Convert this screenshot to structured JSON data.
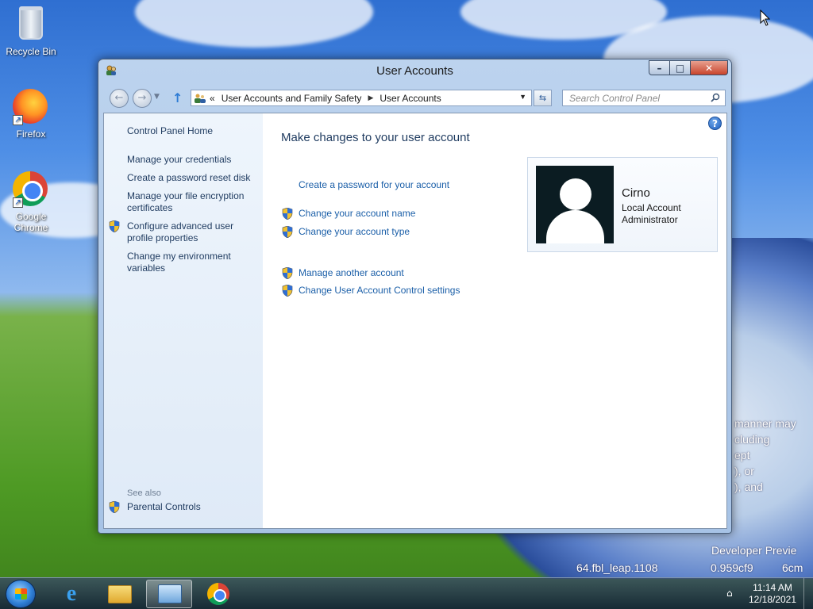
{
  "desktop": {
    "icons": [
      {
        "label": "Recycle Bin",
        "icon": "recycle-bin-icon"
      },
      {
        "label": "Firefox",
        "icon": "firefox-icon"
      },
      {
        "label": "Google Chrome",
        "icon": "chrome-icon"
      }
    ],
    "wallpaper_text": {
      "line1": "manner may",
      "line2": "cluding",
      "line3": "ept",
      "line4": "), or",
      "line5": "), and",
      "line6": "Developer Previe",
      "line7": "64.fbl_leap.1108",
      "line8": "0.959cf9",
      "line9": "6cm"
    }
  },
  "window": {
    "title": "User Accounts",
    "controls": {
      "minimize": "–",
      "maximize": "□",
      "close": "✕"
    },
    "breadcrumb": {
      "prefix": "«",
      "items": [
        "User Accounts and Family Safety",
        "User Accounts"
      ]
    },
    "search_placeholder": "Search Control Panel",
    "help": "?"
  },
  "left_pane": {
    "home": "Control Panel Home",
    "links": [
      "Manage your credentials",
      "Create a password reset disk",
      "Manage your file encryption certificates",
      "Configure advanced user profile properties",
      "Change my environment variables"
    ],
    "see_also_label": "See also",
    "see_also_links": [
      "Parental Controls"
    ]
  },
  "main": {
    "heading": "Make changes to your user account",
    "tasks_group1": [
      {
        "label": "Create a password for your account",
        "shield": false
      },
      {
        "label": "Change your account name",
        "shield": true
      },
      {
        "label": "Change your account type",
        "shield": true
      }
    ],
    "tasks_group2": [
      {
        "label": "Manage another account",
        "shield": true
      },
      {
        "label": "Change User Account Control settings",
        "shield": true
      }
    ]
  },
  "account": {
    "name": "Cirno",
    "type": "Local Account",
    "role": "Administrator"
  },
  "taskbar": {
    "time": "11:14 AM",
    "date": "12/18/2021",
    "apps": [
      "internet-explorer-icon",
      "file-explorer-icon",
      "control-panel-icon",
      "chrome-icon"
    ]
  },
  "colors": {
    "link": "#1b5fa8",
    "heading": "#1e3a5f",
    "close_button": "#c8442c"
  }
}
